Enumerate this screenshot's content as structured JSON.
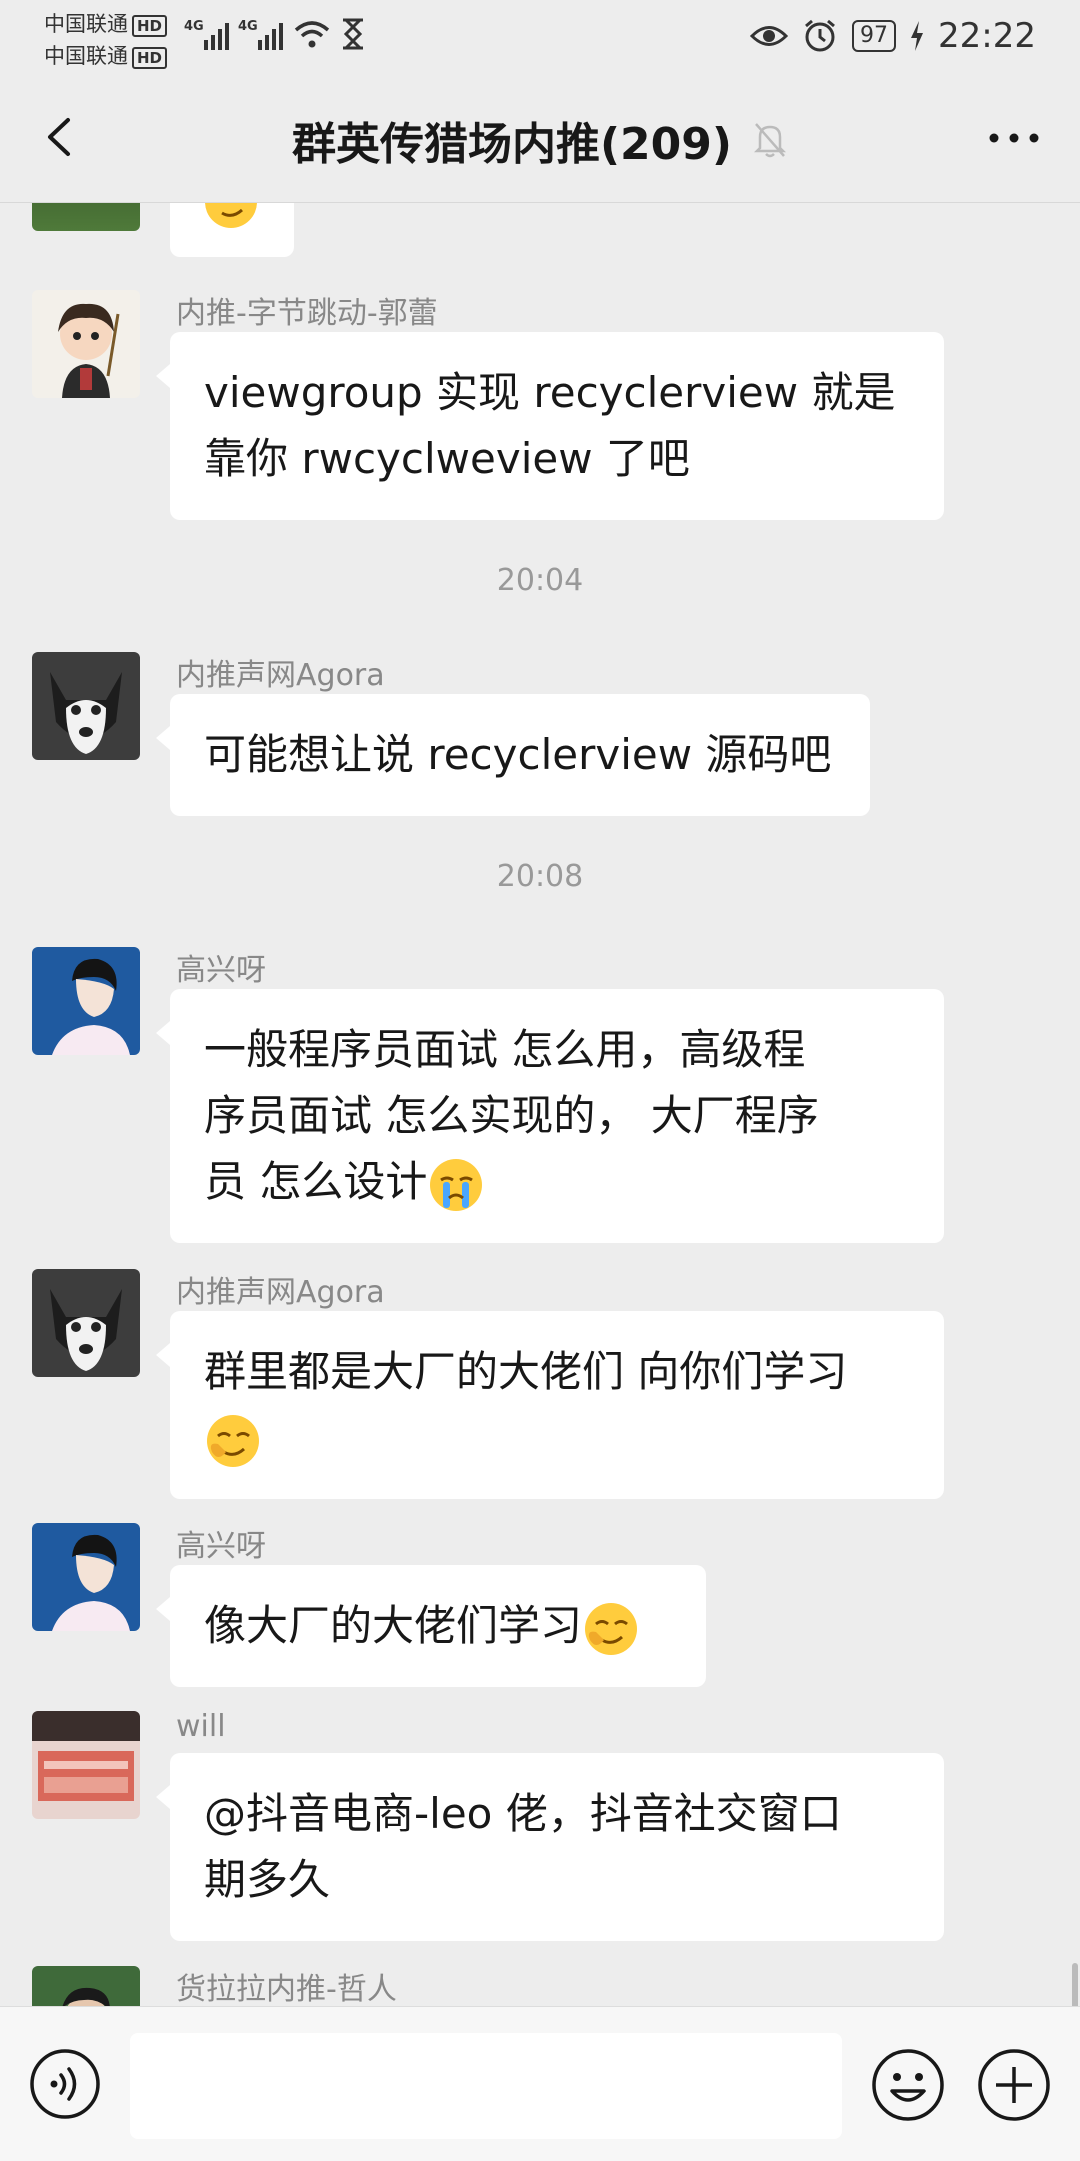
{
  "status_bar": {
    "carrier1": "中国联通",
    "carrier2": "中国联通",
    "hd": "HD",
    "net1": "4G",
    "net2": "4G",
    "battery": "97",
    "time": "22:22"
  },
  "header": {
    "title": "群英传猎场内推(209)"
  },
  "messages": [
    {
      "sender": "内推-字节跳动-郭蕾",
      "text_lines": [
        "viewgroup 实现 recyclerview 就是",
        "靠你 rwcyclweview 了吧"
      ]
    },
    {
      "time": "20:04"
    },
    {
      "sender": "内推声网Agora",
      "text_lines": [
        "可能想让说 recyclerview 源码吧"
      ]
    },
    {
      "time": "20:08"
    },
    {
      "sender": "高兴呀",
      "text_lines": [
        "一般程序员面试   怎么用，高级程",
        "序员面试  怎么实现的，  大厂程序",
        "员  怎么设计"
      ]
    },
    {
      "sender": "内推声网Agora",
      "text_lines": [
        "群里都是大厂的大佬们 向你们学习"
      ]
    },
    {
      "sender": "高兴呀",
      "text_lines": [
        "像大厂的大佬们学习"
      ]
    },
    {
      "sender": "will",
      "text_lines": [
        "@抖音电商-leo  佬，抖音社交窗口",
        "期多久"
      ]
    },
    {
      "sender": "货拉拉内推-哲人"
    }
  ],
  "colors": {
    "bubble": "#ffffff",
    "background": "#ededed",
    "meta_text": "#888888"
  },
  "icons": [
    "back-icon",
    "mute-bell-icon",
    "more-icon",
    "voice-icon",
    "emoji-icon",
    "plus-icon",
    "smirk-emoji",
    "cry-emoji"
  ]
}
